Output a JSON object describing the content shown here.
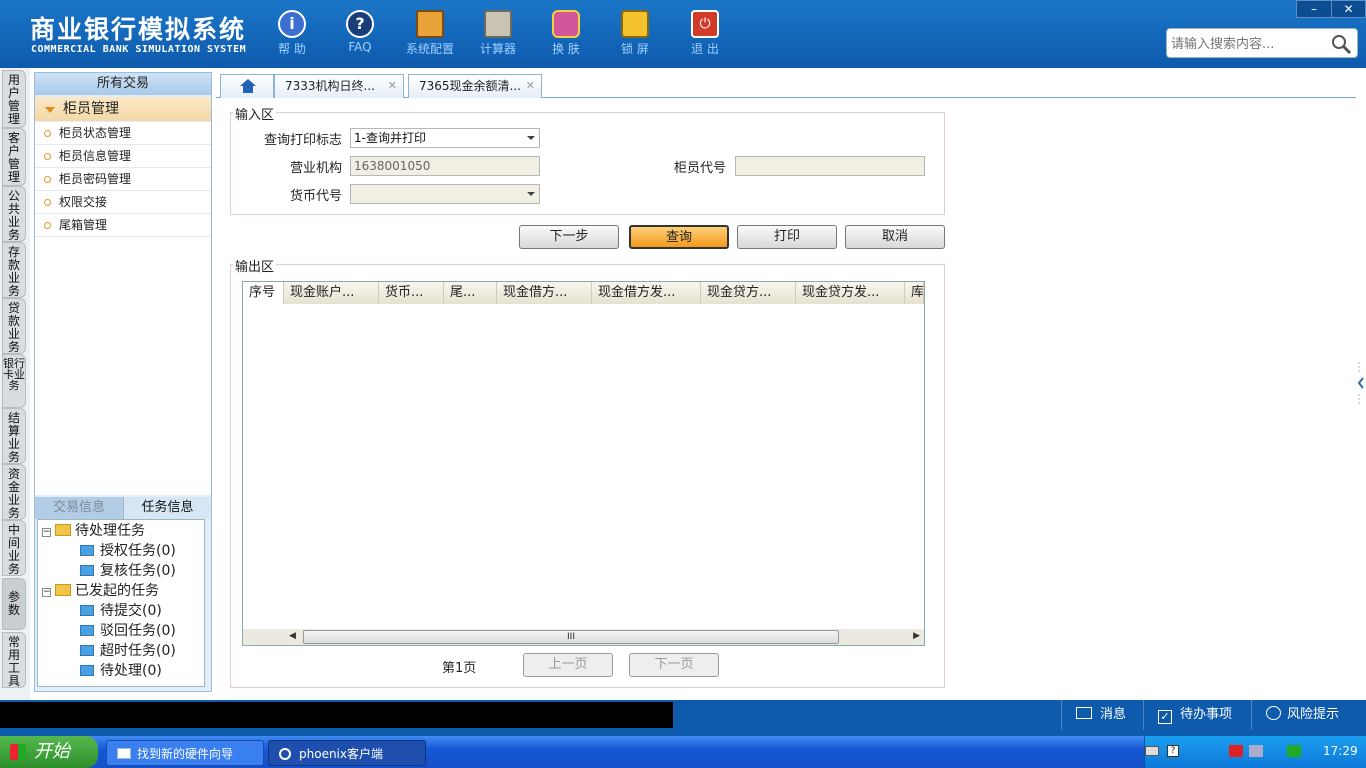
{
  "header": {
    "title_cn": "商业银行模拟系统",
    "title_en": "COMMERCIAL BANK SIMULATION SYSTEM",
    "toolbar": [
      {
        "label": "帮 助",
        "icon": "info-icon"
      },
      {
        "label": "FAQ",
        "icon": "question-icon"
      },
      {
        "label": "系统配置",
        "icon": "toolbox-icon"
      },
      {
        "label": "计算器",
        "icon": "calculator-icon"
      },
      {
        "label": "换 肤",
        "icon": "shirt-icon"
      },
      {
        "label": "锁 屏",
        "icon": "lock-icon"
      },
      {
        "label": "退 出",
        "icon": "power-icon"
      }
    ],
    "search_placeholder": "请输入搜索内容...",
    "window_minimize": "–",
    "window_close": "✕"
  },
  "left_nav": [
    "用户管理",
    "客户管理",
    "公共业务",
    "存款业务",
    "贷款业务",
    "银行卡业务",
    "结算业务",
    "资金业务",
    "中间业务",
    "参数",
    "常用工具"
  ],
  "sidebar": {
    "header": "所有交易",
    "group": "柜员管理",
    "items": [
      "柜员状态管理",
      "柜员信息管理",
      "柜员密码管理",
      "权限交接",
      "尾箱管理"
    ],
    "task_tabs": [
      "交易信息",
      "任务信息"
    ],
    "tree": [
      {
        "label": "待处理任务",
        "level": 0
      },
      {
        "label": "授权任务(0)",
        "level": 1
      },
      {
        "label": "复核任务(0)",
        "level": 1
      },
      {
        "label": "已发起的任务",
        "level": 0
      },
      {
        "label": "待提交(0)",
        "level": 1
      },
      {
        "label": "驳回任务(0)",
        "level": 1
      },
      {
        "label": "超时任务(0)",
        "level": 1
      },
      {
        "label": "待处理(0)",
        "level": 1
      }
    ]
  },
  "tabs": [
    {
      "label": "7333机构日终..."
    },
    {
      "label": "7365现金余额清..."
    }
  ],
  "form": {
    "input_legend": "输入区",
    "query_flag_label": "查询打印标志",
    "query_flag_value": "1-查询并打印",
    "org_label": "营业机构",
    "org_value": "1638001050",
    "teller_label": "柜员代号",
    "teller_value": "",
    "currency_label": "货币代号",
    "currency_value": ""
  },
  "buttons": {
    "next": "下一步",
    "query": "查询",
    "print": "打印",
    "cancel": "取消"
  },
  "output": {
    "legend": "输出区",
    "columns": [
      "序号",
      "现金账户...",
      "货币...",
      "尾...",
      "现金借方...",
      "现金借方发...",
      "现金贷方...",
      "现金贷方发...",
      "库"
    ],
    "page_label": "第1页",
    "prev_page": "上一页",
    "next_page": "下一页",
    "scroll_grip": "III"
  },
  "statusbar": {
    "messages": "消息",
    "todo": "待办事项",
    "risk": "风险提示"
  },
  "taskbar": {
    "start": "开始",
    "tasks": [
      "找到新的硬件向导",
      "phoenix客户端"
    ],
    "clock": "17:29"
  },
  "colors": {
    "header_blue": "#0e5aad",
    "active_button": "#f39a1c",
    "taskbar_green": "#2c8f2a"
  }
}
